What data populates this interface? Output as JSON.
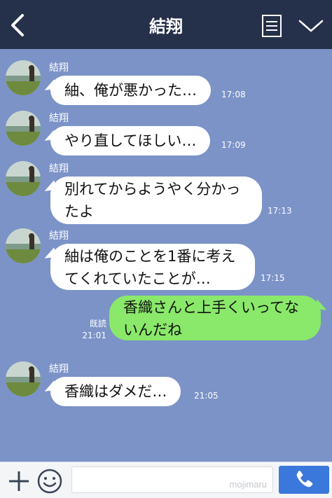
{
  "header": {
    "title": "結翔",
    "back_icon": "chevron-left-icon",
    "menu_icon": "notes-icon",
    "expand_icon": "chevron-down-icon",
    "background": "#25304a"
  },
  "chat": {
    "background": "#7b93c7",
    "messages": [
      {
        "side": "incoming",
        "sender": "結翔",
        "text": "紬、俺が悪かった…",
        "time": "17:08"
      },
      {
        "side": "incoming",
        "sender": "結翔",
        "text": "やり直してほしい…",
        "time": "17:09"
      },
      {
        "side": "incoming",
        "sender": "結翔",
        "text": "別れてからようやく分かっ\nたよ",
        "time": "17:13"
      },
      {
        "side": "incoming",
        "sender": "結翔",
        "text": "紬は俺のことを1番に考え\nてくれていたことが…",
        "time": "17:15"
      },
      {
        "side": "outgoing",
        "text": "香織さんと上手くいってな\nいんだね",
        "read_label": "既読",
        "time": "21:01"
      },
      {
        "side": "incoming",
        "sender": "結翔",
        "text": "香織はダメだ…",
        "time": "21:05"
      }
    ]
  },
  "input_bar": {
    "plus_icon": "plus-icon",
    "emoji_icon": "smiley-icon",
    "value": "",
    "watermark": "mojimaru",
    "call_icon": "phone-icon",
    "call_color": "#3b78dc"
  },
  "colors": {
    "incoming_bubble": "#ffffff",
    "outgoing_bubble": "#8ae86a"
  }
}
